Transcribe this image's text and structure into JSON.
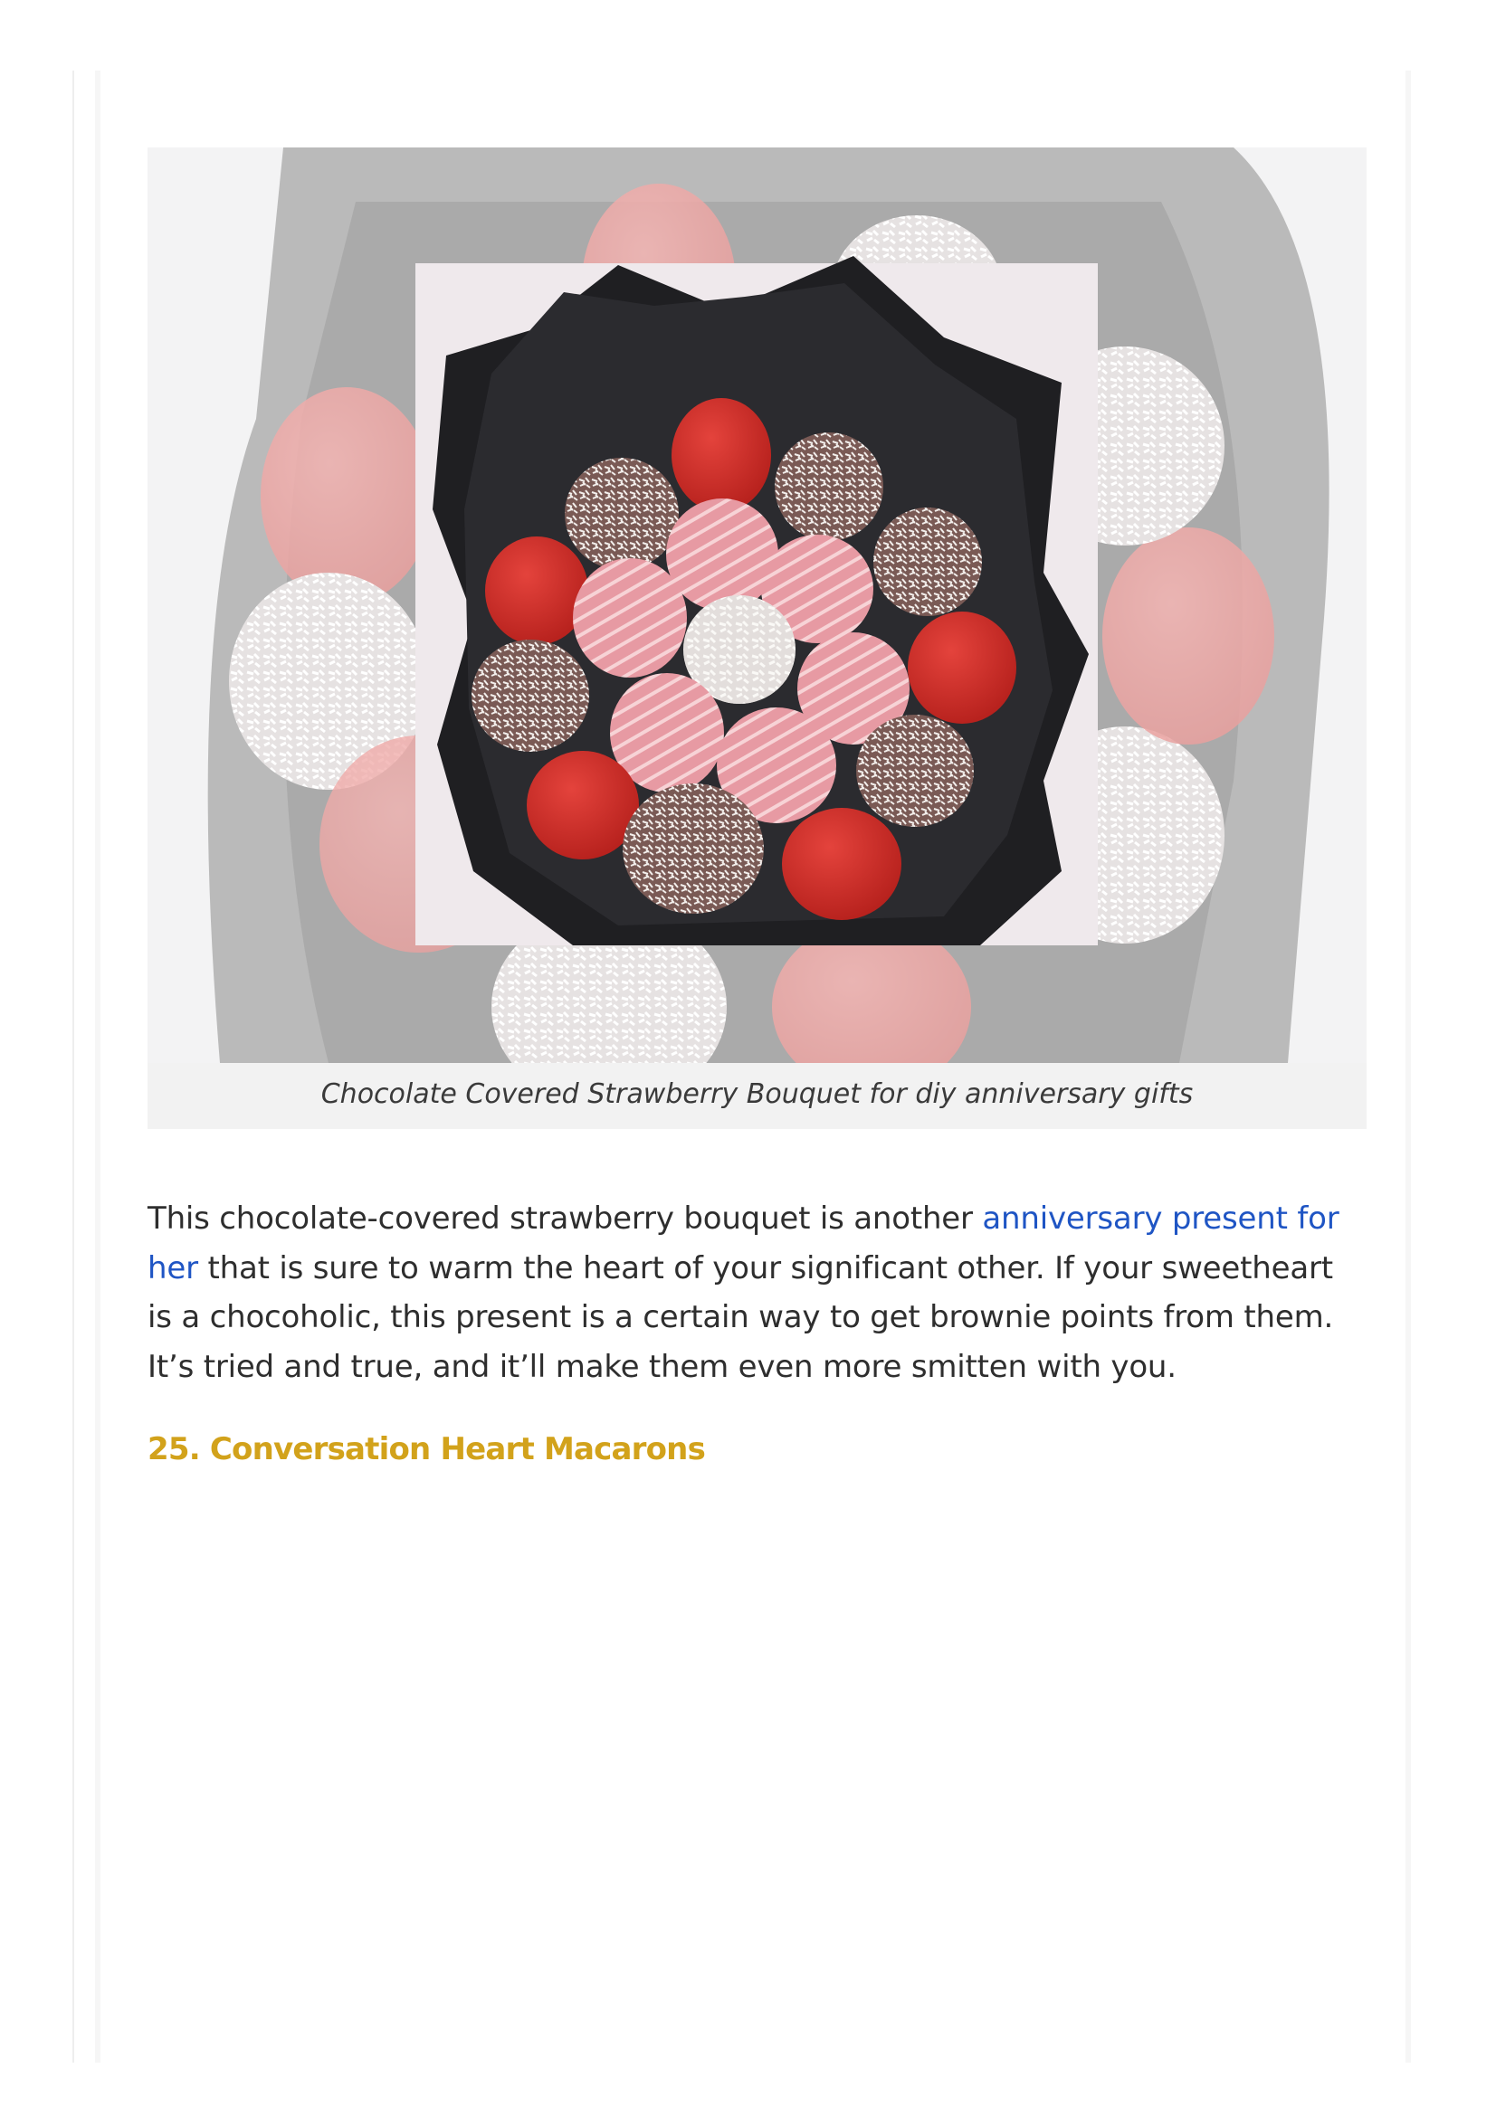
{
  "figure": {
    "image_alt": "Chocolate Covered Strawberry Bouquet",
    "caption": "Chocolate Covered Strawberry Bouquet for diy anniversary gifts"
  },
  "paragraph": {
    "text_before_link": "This chocolate-covered strawberry bouquet is another ",
    "link_text": "anniversary present for her",
    "text_after_link": " that is sure to warm the heart of your significant other. If your sweetheart is a chocoholic, this present is a certain way to get brownie points from them. It’s tried and true, and it’ll make them even more smitten with you."
  },
  "next_section": {
    "heading": "25. Conversation Heart Macarons"
  },
  "colors": {
    "link": "#1f55c4",
    "heading": "#d2a21b",
    "caption_bg": "#f2f2f2"
  }
}
